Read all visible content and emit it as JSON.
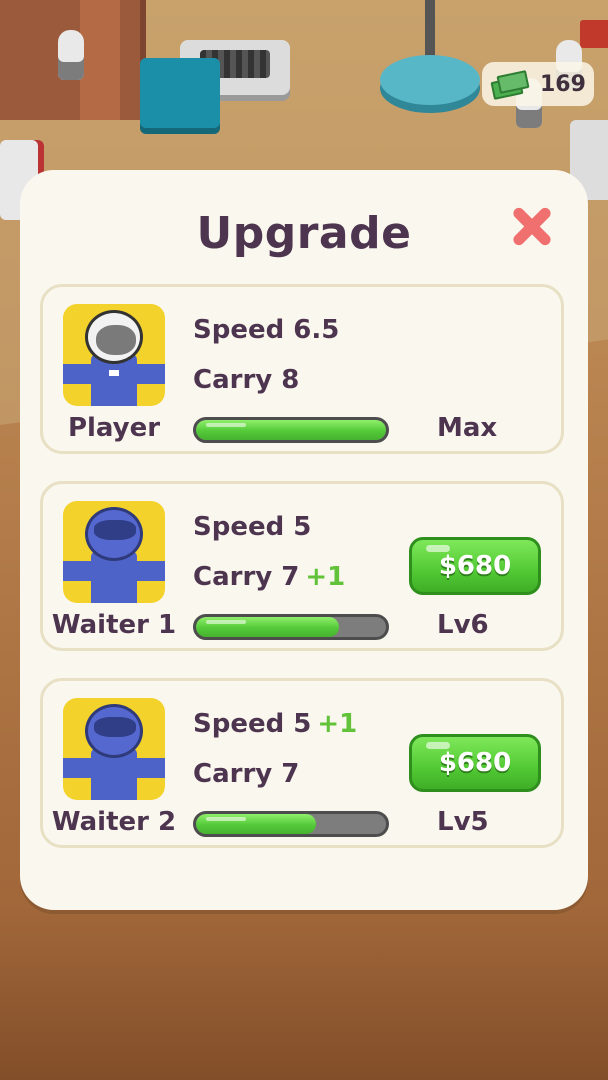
{
  "money": {
    "amount": "169",
    "icon": "cash-stack-icon"
  },
  "panel": {
    "title": "Upgrade",
    "close_icon": "close-x-icon"
  },
  "cards": [
    {
      "name": "Player",
      "speed": "Speed 6.5",
      "carry": "Carry 8",
      "carry_bonus": "",
      "speed_bonus": "",
      "progress": 1.0,
      "level": "Max",
      "price": ""
    },
    {
      "name": "Waiter 1",
      "speed": "Speed 5",
      "carry": "Carry 7",
      "carry_bonus": "+1",
      "speed_bonus": "",
      "progress": 0.75,
      "level": "Lv6",
      "price": "$680"
    },
    {
      "name": "Waiter 2",
      "speed": "Speed 5",
      "carry": "Carry 7",
      "carry_bonus": "",
      "speed_bonus": "+1",
      "progress": 0.63,
      "level": "Lv5",
      "price": "$680"
    }
  ],
  "colors": {
    "panel_bg": "#faf7ee",
    "text": "#4d3550",
    "accent_green": "#52c934",
    "bonus_green": "#62c33a",
    "close_red": "#f07070",
    "avatar_bg": "#f4d22c"
  }
}
